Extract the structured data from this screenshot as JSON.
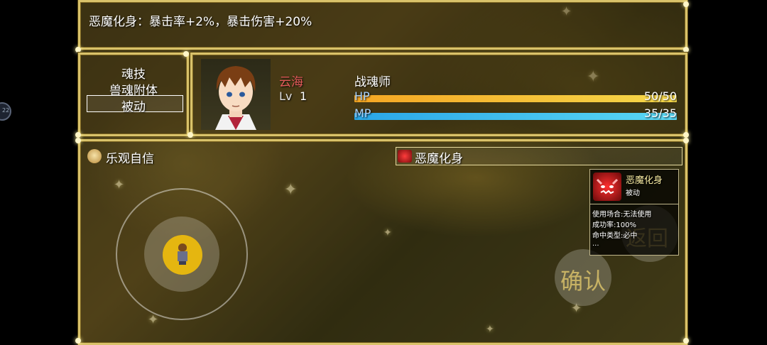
{
  "help": {
    "text": "恶魔化身：暴击率+2%，暴击伤害+20%"
  },
  "skill_types": {
    "items": [
      "魂技",
      "兽魂附体",
      "被动"
    ],
    "selected_index": 2
  },
  "actor": {
    "name": "云海",
    "level_label": "Lv",
    "level": "1",
    "class": "战魂师",
    "hp_label": "HP",
    "hp_value": "50/50",
    "hp_fraction": 1.0,
    "mp_label": "MP",
    "mp_value": "35/35",
    "mp_fraction": 1.0
  },
  "skill_list": {
    "items": [
      {
        "name": "乐观自信",
        "icon": "lion-icon"
      },
      {
        "name": "恶魔化身",
        "icon": "demon-icon"
      }
    ],
    "selected_index": 1
  },
  "detail": {
    "name": "恶魔化身",
    "type": "被动",
    "icon": "demon-icon",
    "usage": "使用场合:无法使用",
    "success": "成功率:100%",
    "hit": "命中类型:必中",
    "more": "..."
  },
  "buttons": {
    "back": "返回",
    "confirm": "确认"
  },
  "left_edge_icon": {
    "label": "22"
  },
  "colors": {
    "hp": "#f5c531",
    "mp": "#38c8ef",
    "gold": "#d9c26a",
    "name": "#e35a5a"
  }
}
